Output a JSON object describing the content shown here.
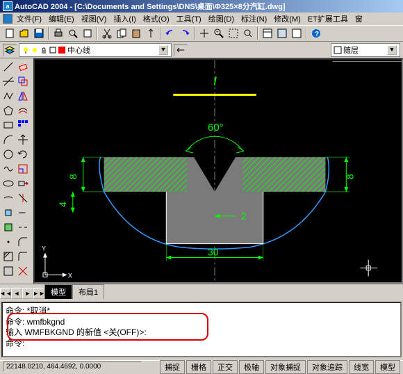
{
  "titlebar": {
    "icon_letter": "a",
    "title": "AutoCAD 2004 - [C:\\Documents and Settings\\DNS\\桌面\\Φ325×8分汽缸.dwg]"
  },
  "menu": {
    "items": [
      "文件(F)",
      "编辑(E)",
      "视图(V)",
      "插入(I)",
      "格式(O)",
      "工具(T)",
      "绘图(D)",
      "标注(N)",
      "修改(M)",
      "ET扩展工具",
      "窗"
    ]
  },
  "layers": {
    "current_name": "中心线",
    "color_layer_label": "随层"
  },
  "tabs": {
    "nav": [
      "◄◄",
      "◄",
      "►",
      "►►"
    ],
    "items": [
      "模型",
      "布局1"
    ],
    "active": 0
  },
  "command": {
    "lines": [
      "命令: *取消*",
      "命令: wmfbkgnd",
      "输入 WMFBKGND 的新值 <关(OFF)>:",
      "命令:"
    ]
  },
  "status": {
    "coords": "22148.0210, 464.4692, 0.0000",
    "buttons": [
      "捕捉",
      "栅格",
      "正交",
      "极轴",
      "对象捕捉",
      "对象追踪",
      "线宽",
      "模型"
    ]
  },
  "drawing": {
    "label_top": "I",
    "angle": "60°",
    "dim_left1": "8",
    "dim_left2": "4",
    "dim_right": "8",
    "dim_bottom1": "2",
    "dim_bottom2": "30"
  }
}
